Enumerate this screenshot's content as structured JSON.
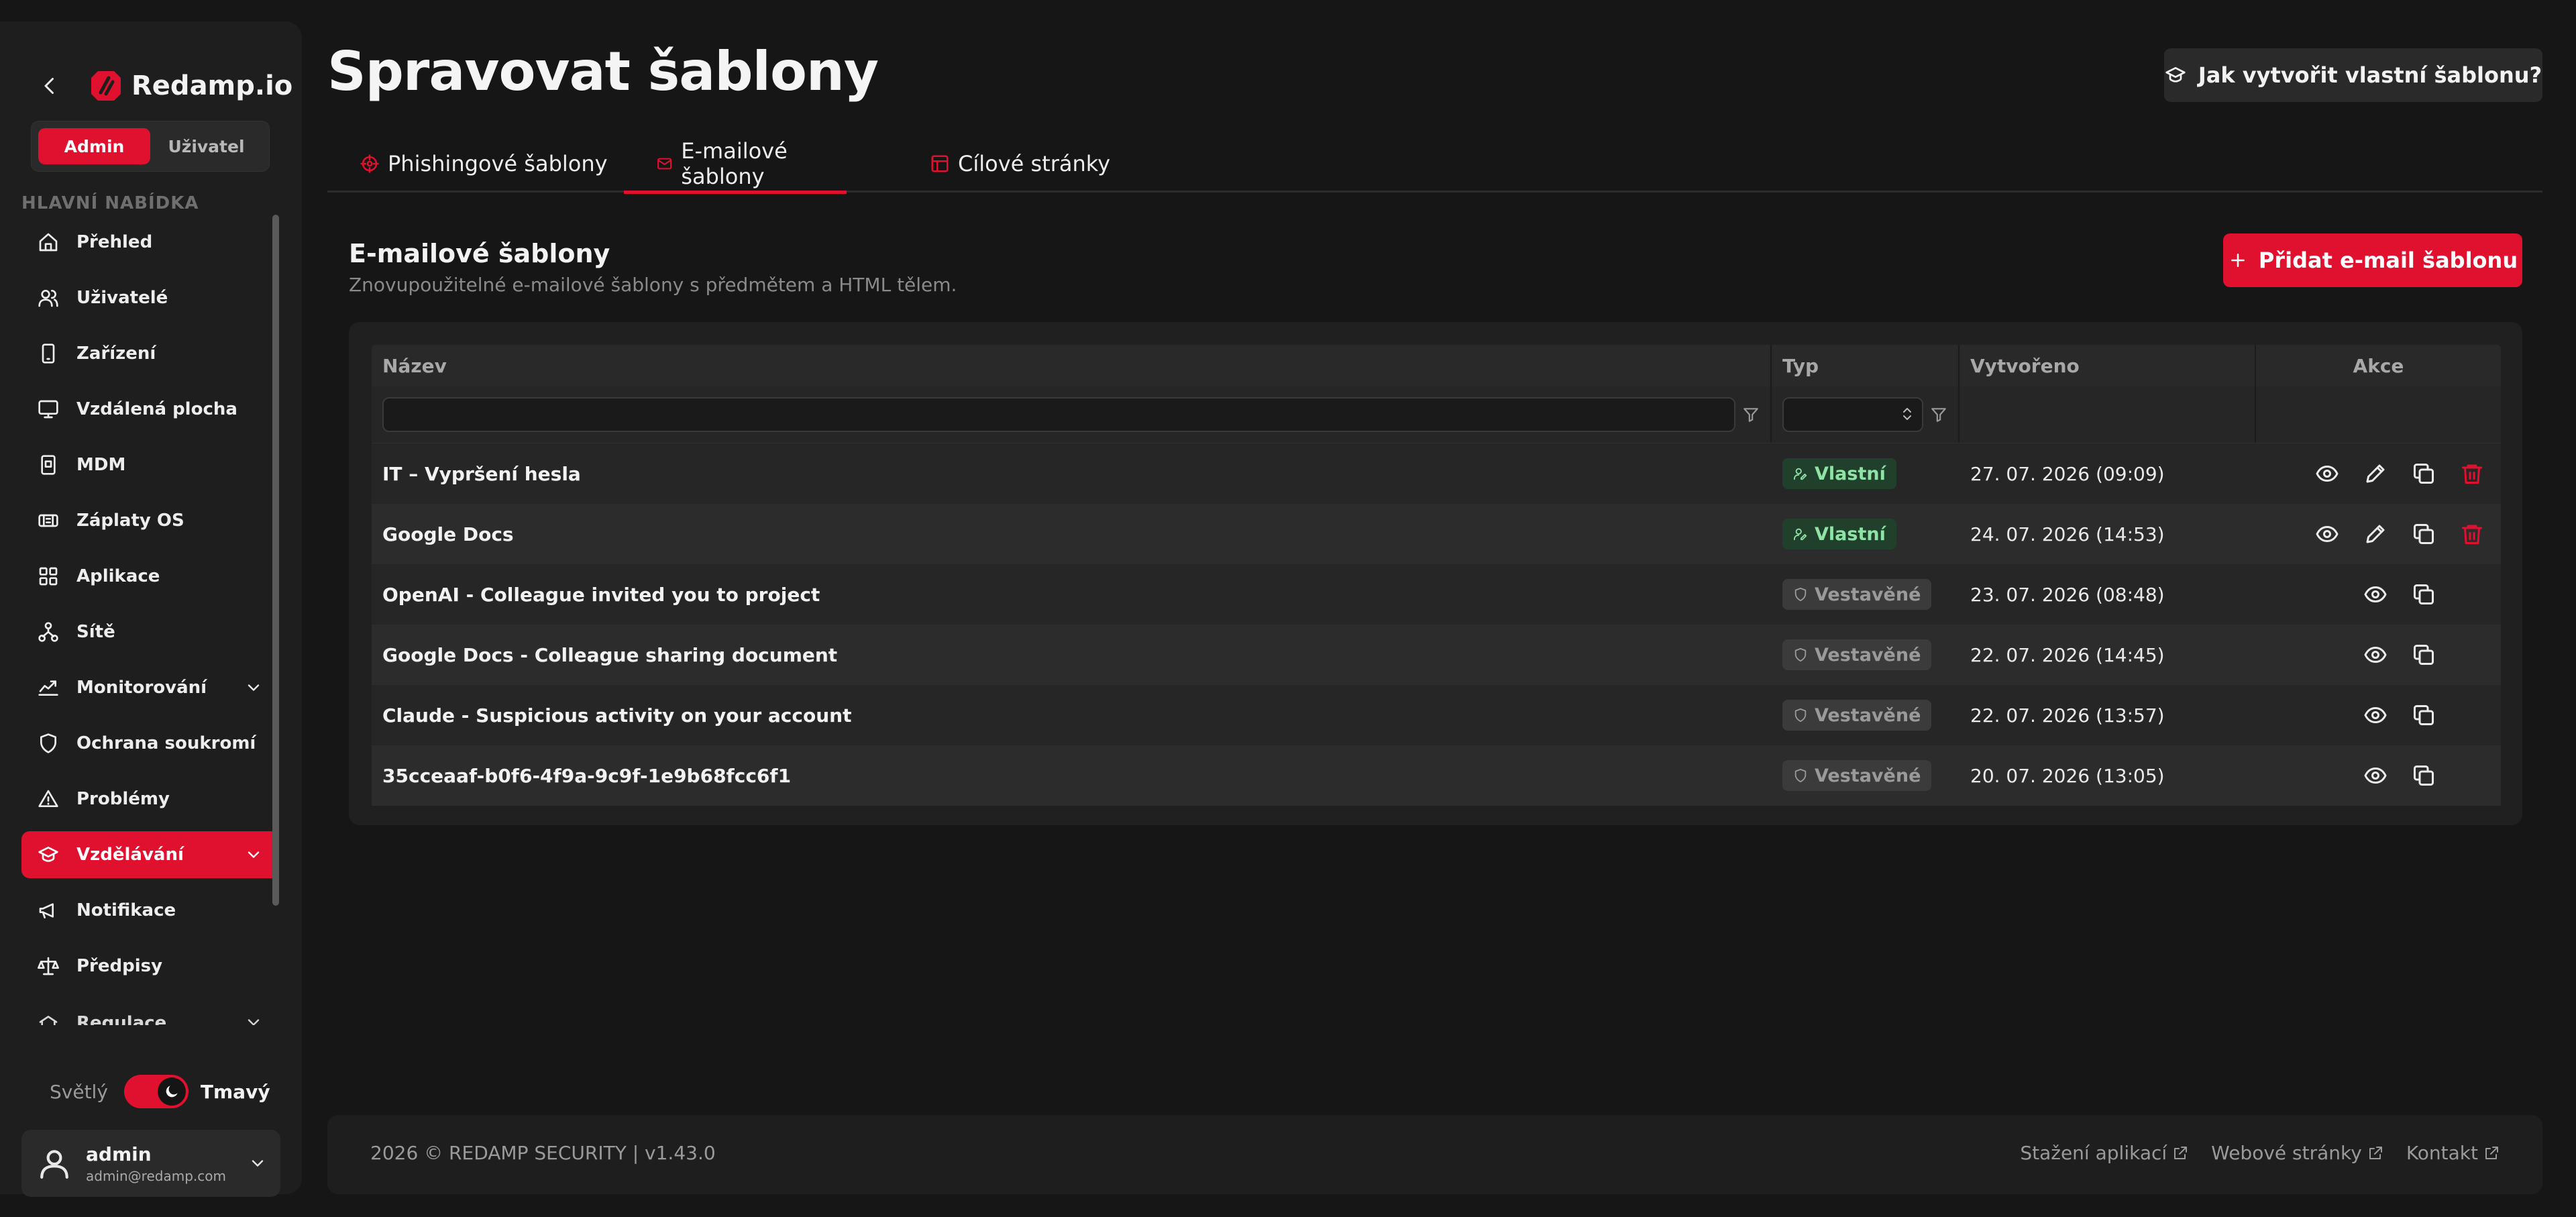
{
  "brand": {
    "name": "Redamp.io",
    "accent": "#e0102f"
  },
  "role_switch": {
    "admin": "Admin",
    "user": "Uživatel",
    "active": "admin"
  },
  "menu": {
    "heading": "HLAVNÍ NABÍDKA",
    "items": [
      {
        "label": "Přehled",
        "icon": "home-icon"
      },
      {
        "label": "Uživatelé",
        "icon": "users-icon"
      },
      {
        "label": "Zařízení",
        "icon": "device-icon"
      },
      {
        "label": "Vzdálená plocha",
        "icon": "monitor-icon"
      },
      {
        "label": "MDM",
        "icon": "mdm-icon"
      },
      {
        "label": "Záplaty OS",
        "icon": "patch-icon"
      },
      {
        "label": "Aplikace",
        "icon": "apps-icon"
      },
      {
        "label": "Sítě",
        "icon": "network-icon"
      },
      {
        "label": "Monitorování",
        "icon": "monitoring-icon"
      },
      {
        "label": "Ochrana soukromí",
        "icon": "shield-icon"
      },
      {
        "label": "Problémy",
        "icon": "warning-icon"
      },
      {
        "label": "Vzdělávání",
        "icon": "graduation-cap-icon",
        "active": true
      },
      {
        "label": "Notifikace",
        "icon": "megaphone-icon"
      },
      {
        "label": "Předpisy",
        "icon": "scale-icon"
      },
      {
        "label": "Regulace",
        "icon": "regulation-icon"
      }
    ]
  },
  "theme": {
    "light": "Světlý",
    "dark": "Tmavý",
    "current": "dark"
  },
  "user": {
    "name": "admin",
    "email": "admin@redamp.com"
  },
  "page": {
    "title": "Spravovat šablony",
    "help_button": "Jak vytvořit vlastní šablonu?"
  },
  "tabs": [
    {
      "label": "Phishingové šablony",
      "icon": "fishing-hook-icon"
    },
    {
      "label": "E-mailové šablony",
      "icon": "mail-icon",
      "active": true
    },
    {
      "label": "Cílové stránky",
      "icon": "layout-icon"
    }
  ],
  "panel": {
    "title": "E-mailové šablony",
    "subtitle": "Znovupoužitelné e-mailové šablony s předmětem a HTML tělem.",
    "add_button": "Přidat e-mail šablonu"
  },
  "table": {
    "columns": {
      "name": "Název",
      "type": "Typ",
      "created": "Vytvořeno",
      "actions": "Akce"
    },
    "filters": {
      "name": "",
      "type": ""
    },
    "rows": [
      {
        "name": "IT – Vypršení hesla",
        "type": "Vlastní",
        "type_kind": "custom",
        "created": "27. 07. 2026 (09:09)"
      },
      {
        "name": "Google Docs",
        "type": "Vlastní",
        "type_kind": "custom",
        "created": "24. 07. 2026 (14:53)"
      },
      {
        "name": "OpenAI - Colleague invited you to project",
        "type": "Vestavěné",
        "type_kind": "builtin",
        "created": "23. 07. 2026 (08:48)"
      },
      {
        "name": "Google Docs - Colleague sharing document",
        "type": "Vestavěné",
        "type_kind": "builtin",
        "created": "22. 07. 2026 (14:45)"
      },
      {
        "name": "Claude - Suspicious activity on your account",
        "type": "Vestavěné",
        "type_kind": "builtin",
        "created": "22. 07. 2026 (13:57)"
      },
      {
        "name": "35cceaaf-b0f6-4f9a-9c9f-1e9b68fcc6f1",
        "type": "Vestavěné",
        "type_kind": "builtin",
        "created": "20. 07. 2026 (13:05)"
      }
    ]
  },
  "footer": {
    "copyright": "2026 © REDAMP SECURITY | v1.43.0",
    "links": [
      "Stažení aplikací",
      "Webové stránky",
      "Kontakt"
    ]
  }
}
